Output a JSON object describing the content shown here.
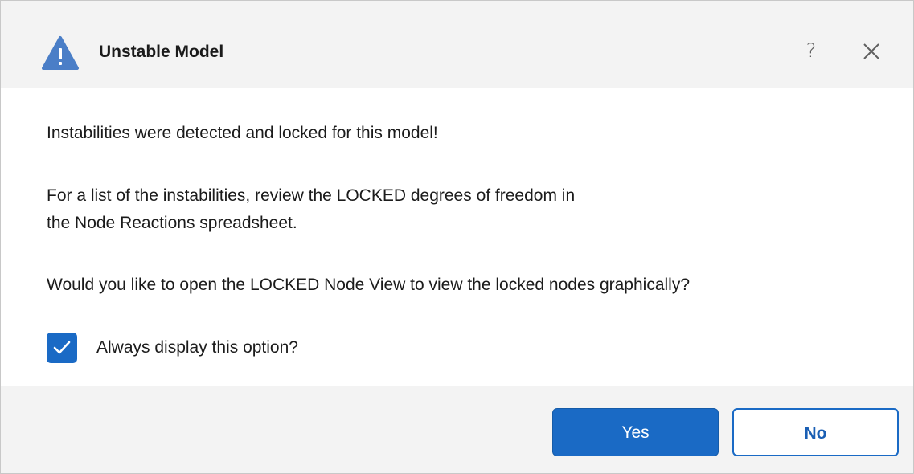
{
  "dialog": {
    "title": "Unstable Model",
    "help_glyph": "?",
    "icon": "warning-icon",
    "accent_color": "#1a6ac5"
  },
  "message": {
    "line1": "Instabilities were detected and locked for this model!",
    "line2": "For a list of the instabilities, review the LOCKED degrees of freedom in",
    "line3": "the Node Reactions spreadsheet.",
    "line4": "Would you like to open the LOCKED Node View to view the locked nodes graphically?"
  },
  "option": {
    "label": "Always display this option?",
    "checked": true
  },
  "buttons": {
    "yes": "Yes",
    "no": "No"
  }
}
